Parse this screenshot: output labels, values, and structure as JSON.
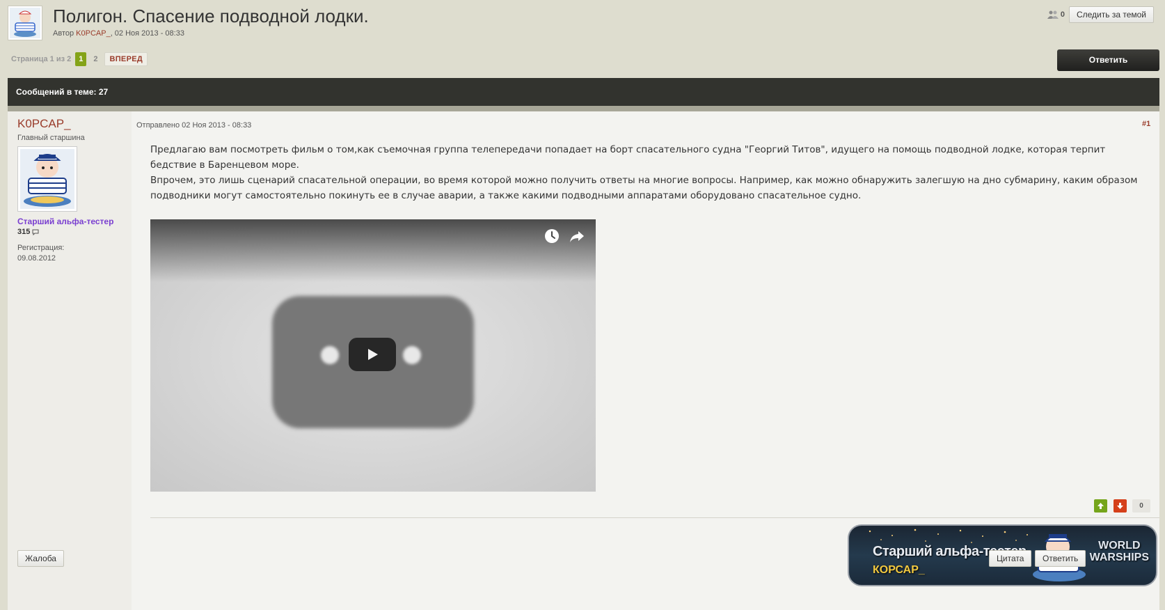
{
  "topic": {
    "title": "Полигон. Спасение подводной лодки.",
    "meta_prefix": "Автор",
    "meta_author": "K0PCAP_",
    "meta_date": ", 02 Ноя 2013 - 08:33"
  },
  "follow": {
    "count": "0",
    "label": "Следить за темой"
  },
  "pagination": {
    "label": "Страница 1 из 2",
    "current": "1",
    "pages": [
      "2"
    ],
    "next": "ВПЕРЕД"
  },
  "reply_top_label": "Ответить",
  "messages_count_label": "Сообщений в теме: 27",
  "post": {
    "author_name": "K0PCAP_",
    "author_rank": "Главный старшина",
    "author_group": "Старший альфа-тестер",
    "author_posts": "315",
    "reg_label": "Регистрация:",
    "reg_date": "09.08.2012",
    "posted": "Отправлено 02 Ноя 2013 - 08:33",
    "number": "#1",
    "paragraph1": "Предлагаю вам посмотреть фильм о том,как съемочная группа телепередачи попадает на борт спасательного судна \"Георгий Титов\", идущего на помощь подводной лодке, которая терпит бедствие в Баренцевом море.",
    "paragraph2": "Впрочем, это лишь сценарий спасательной операции, во время которой можно получить ответы на многие вопросы. Например, как можно обнаружить залегшую на дно субмарину, каким образом подводники могут самостоятельно покинуть ее в случае аварии, а также какими подводными аппаратами оборудовано спасательное судно.",
    "reputation": "0",
    "signature_line1": "Старший альфа-тестер",
    "signature_line2": "КОРСАР_",
    "signature_brand_line1": "WORLD",
    "signature_brand_line2": "WARSHIPS",
    "complain_label": "Жалоба",
    "quote_label": "Цитата",
    "reply_label": "Ответить"
  },
  "colors": {
    "accent_red": "#9a3c2b",
    "page_green": "#84a318",
    "group_purple": "#7a3fd0",
    "rep_up": "#75a51b",
    "rep_down": "#d5401a",
    "bar_dark": "#32332e"
  },
  "icons": [
    "topic-avatar",
    "followers-icon",
    "posts-bubble-icon",
    "clock-icon",
    "share-icon",
    "play-icon",
    "thumb-up-icon",
    "thumb-down-icon"
  ]
}
